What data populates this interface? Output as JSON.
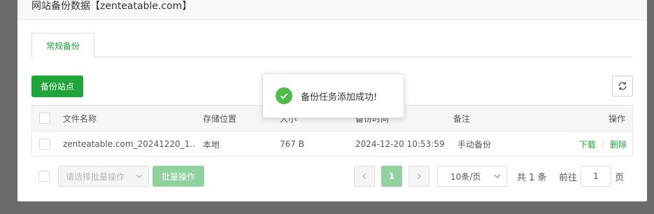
{
  "dialog": {
    "title": "网站备份数据【zenteatable.com】"
  },
  "tabs": [
    {
      "label": "常规备份"
    }
  ],
  "toolbar": {
    "backup_site_label": "备份站点"
  },
  "table": {
    "headers": [
      "文件名称",
      "存储位置",
      "大小",
      "备份时间",
      "备注",
      "操作"
    ],
    "rows": [
      {
        "filename": "zenteatable.com_20241220_1...",
        "location": "本地",
        "size": "767 B",
        "time": "2024-12-20 10:53:59",
        "note": "手动备份",
        "download": "下载",
        "delete": "删除"
      }
    ]
  },
  "footer": {
    "batch_placeholder": "请选择批量操作",
    "batch_button": "批量操作",
    "current_page": "1",
    "per_page": "10条/页",
    "total": "共 1 条",
    "goto_prefix": "前往",
    "goto_value": "1",
    "goto_suffix": "页"
  },
  "toast": {
    "message": "备份任务添加成功!"
  },
  "colors": {
    "accent": "#20a53a",
    "accent_light": "#8fd29d",
    "toast_icon": "#4cbb4a"
  }
}
